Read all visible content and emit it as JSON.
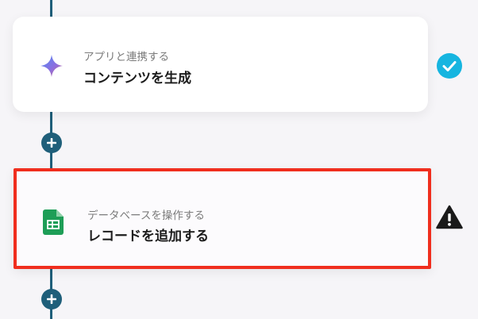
{
  "steps": [
    {
      "subtitle": "アプリと連携する",
      "title": "コンテンツを生成",
      "icon": "gemini-sparkle-icon",
      "status": "complete",
      "status_icon": "check-circle-icon",
      "status_color": "#16b5e0"
    },
    {
      "subtitle": "データベースを操作する",
      "title": "レコードを追加する",
      "icon": "google-sheets-icon",
      "status": "warning",
      "status_icon": "warning-triangle-icon",
      "status_color": "#1a1a1a",
      "highlight_color": "#f02e1e"
    }
  ],
  "colors": {
    "flow_line": "#1f5f7a",
    "add_button": "#1f5f7a",
    "background": "#f6f5f8"
  }
}
